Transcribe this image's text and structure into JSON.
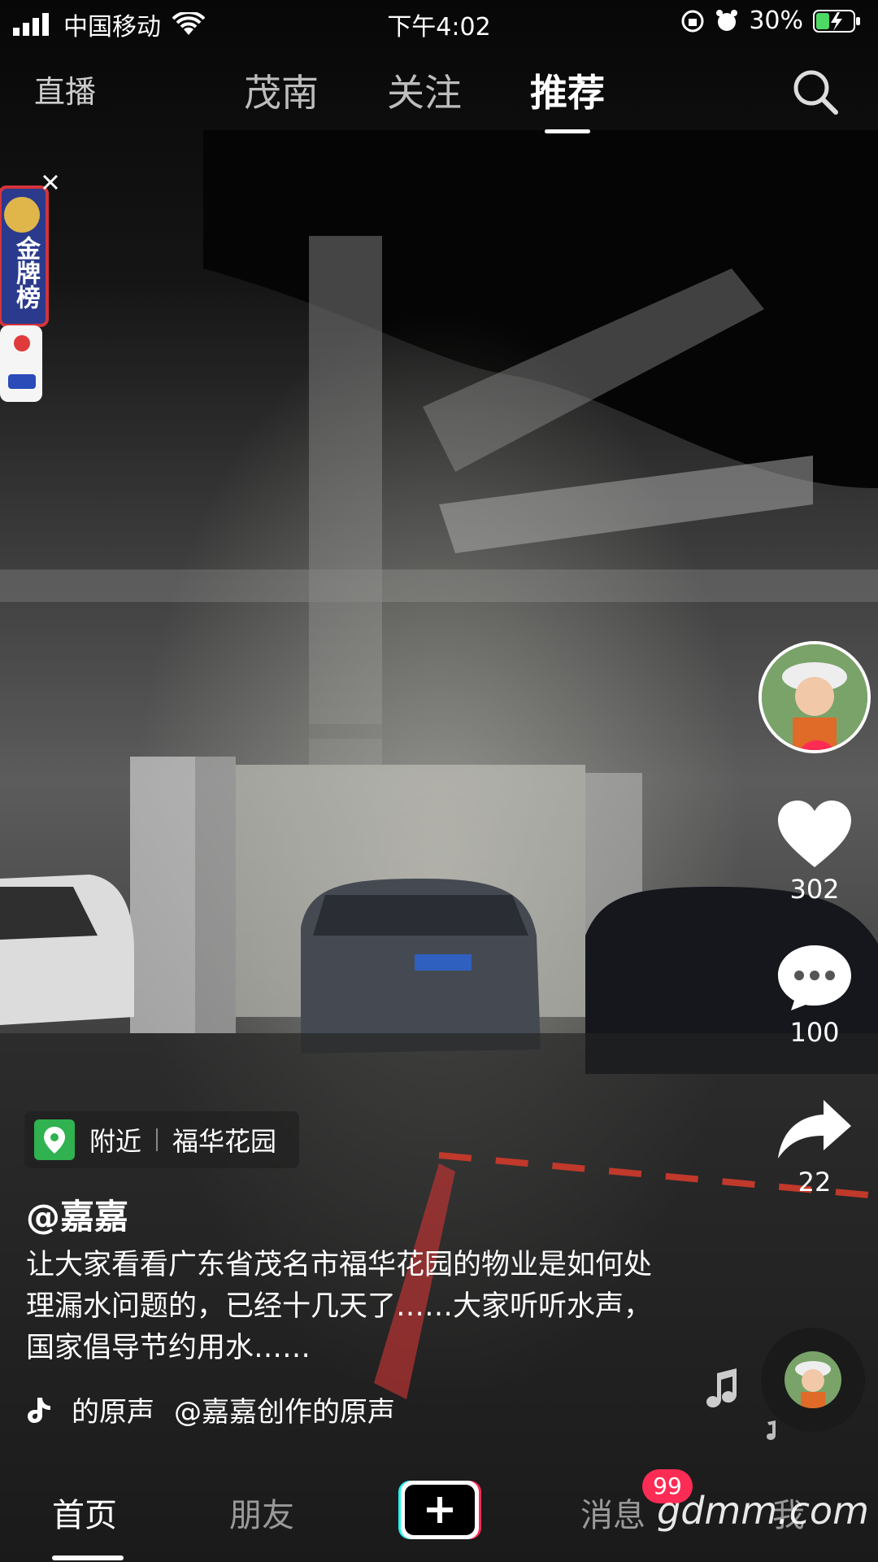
{
  "status_bar": {
    "carrier": "中国移动",
    "time": "下午4:02",
    "battery": "30%"
  },
  "top_nav": {
    "live": "直播",
    "tabs": [
      "茂南",
      "关注",
      "推荐"
    ],
    "active_tab": "推荐"
  },
  "badge": {
    "label": "金牌榜"
  },
  "side": {
    "likes": "302",
    "comments": "100",
    "shares": "22"
  },
  "location": {
    "label": "附近",
    "place": "福华花园"
  },
  "post": {
    "username": "@嘉嘉",
    "description": "让大家看看广东省茂名市福华花园的物业是如何处理漏水问题的，已经十几天了……大家听听水声，国家倡导节约用水……",
    "music_left": "的原声",
    "music_right": "@嘉嘉创作的原声"
  },
  "bottom_bar": {
    "home": "首页",
    "friends": "朋友",
    "messages": "消息",
    "messages_badge": "99",
    "me": "我"
  },
  "watermark": "gdmm.com",
  "colors": {
    "accent": "#fe2c55",
    "location_pin": "#2fb24f"
  }
}
